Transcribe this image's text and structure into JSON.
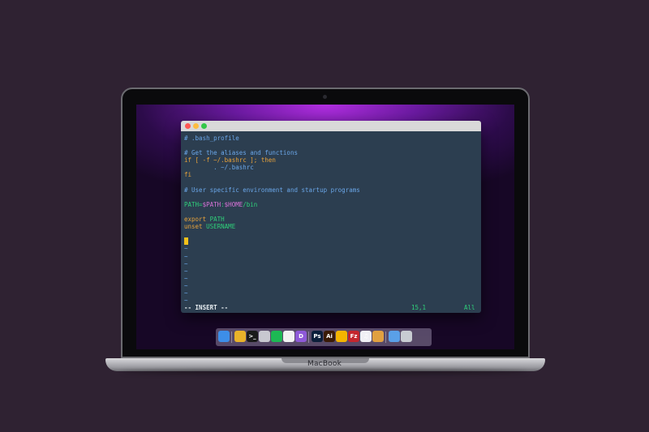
{
  "laptop": {
    "brand": "MacBook"
  },
  "window": {
    "titlebar_buttons": [
      "close",
      "minimize",
      "zoom"
    ]
  },
  "editor": {
    "lines": [
      [
        {
          "t": "# .bash_profile",
          "c": "comment"
        }
      ],
      [
        {
          "t": "",
          "c": "text"
        }
      ],
      [
        {
          "t": "# Get the aliases and functions",
          "c": "comment"
        }
      ],
      [
        {
          "t": "if [ -f ~/.bashrc ]; then",
          "c": "keyword"
        }
      ],
      [
        {
          "t": "        . ~/.bashrc",
          "c": "string"
        }
      ],
      [
        {
          "t": "fi",
          "c": "keyword"
        }
      ],
      [
        {
          "t": "",
          "c": "text"
        }
      ],
      [
        {
          "t": "# User specific environment and startup programs",
          "c": "comment"
        }
      ],
      [
        {
          "t": "",
          "c": "text"
        }
      ],
      [
        {
          "t": "PATH=",
          "c": "path"
        },
        {
          "t": "$PATH",
          "c": "var"
        },
        {
          "t": ":",
          "c": "path"
        },
        {
          "t": "$HOME",
          "c": "var"
        },
        {
          "t": "/bin",
          "c": "path"
        }
      ],
      [
        {
          "t": "",
          "c": "text"
        }
      ],
      [
        {
          "t": "export ",
          "c": "keyword"
        },
        {
          "t": "PATH",
          "c": "path"
        }
      ],
      [
        {
          "t": "unset ",
          "c": "keyword"
        },
        {
          "t": "USERNAME",
          "c": "path"
        }
      ],
      [
        {
          "t": "",
          "c": "text"
        }
      ],
      [
        {
          "t": "CURSOR",
          "c": "cursor"
        }
      ],
      [
        {
          "t": "~",
          "c": "tilde"
        }
      ],
      [
        {
          "t": "~",
          "c": "tilde"
        }
      ],
      [
        {
          "t": "~",
          "c": "tilde"
        }
      ],
      [
        {
          "t": "~",
          "c": "tilde"
        }
      ],
      [
        {
          "t": "~",
          "c": "tilde"
        }
      ],
      [
        {
          "t": "~",
          "c": "tilde"
        }
      ],
      [
        {
          "t": "~",
          "c": "tilde"
        }
      ],
      [
        {
          "t": "~",
          "c": "tilde"
        }
      ]
    ]
  },
  "statusbar": {
    "mode": "-- INSERT --",
    "position": "15,1",
    "scroll": "All"
  },
  "dock": {
    "items": [
      {
        "name": "finder-icon",
        "color": "#3d8ee8",
        "glyph": ""
      },
      {
        "sep": true
      },
      {
        "name": "chrome-icon",
        "color": "#e9b22a",
        "glyph": ""
      },
      {
        "name": "terminal-icon",
        "color": "#1a1a1a",
        "glyph": ">_"
      },
      {
        "name": "sequel-pro-icon",
        "color": "#c8c8d0",
        "glyph": ""
      },
      {
        "name": "spotify-icon",
        "color": "#1db954",
        "glyph": ""
      },
      {
        "name": "github-icon",
        "color": "#f2f2f2",
        "glyph": ""
      },
      {
        "name": "app-icon",
        "color": "#8e59d8",
        "glyph": "D"
      },
      {
        "sep": true
      },
      {
        "name": "photoshop-icon",
        "color": "#0b1e3a",
        "glyph": "Ps"
      },
      {
        "name": "illustrator-icon",
        "color": "#3a1a06",
        "glyph": "Ai"
      },
      {
        "name": "sketch-icon",
        "color": "#f4b400",
        "glyph": ""
      },
      {
        "name": "filezilla-icon",
        "color": "#c4262e",
        "glyph": "Fz"
      },
      {
        "name": "itunes-icon",
        "color": "#f0f0f5",
        "glyph": "♫"
      },
      {
        "name": "burger-app-icon",
        "color": "#e0a040",
        "glyph": ""
      },
      {
        "sep": true
      },
      {
        "name": "folder-icon",
        "color": "#5aa0e8",
        "glyph": ""
      },
      {
        "name": "trash-icon",
        "color": "#c8ccd2",
        "glyph": ""
      }
    ]
  }
}
